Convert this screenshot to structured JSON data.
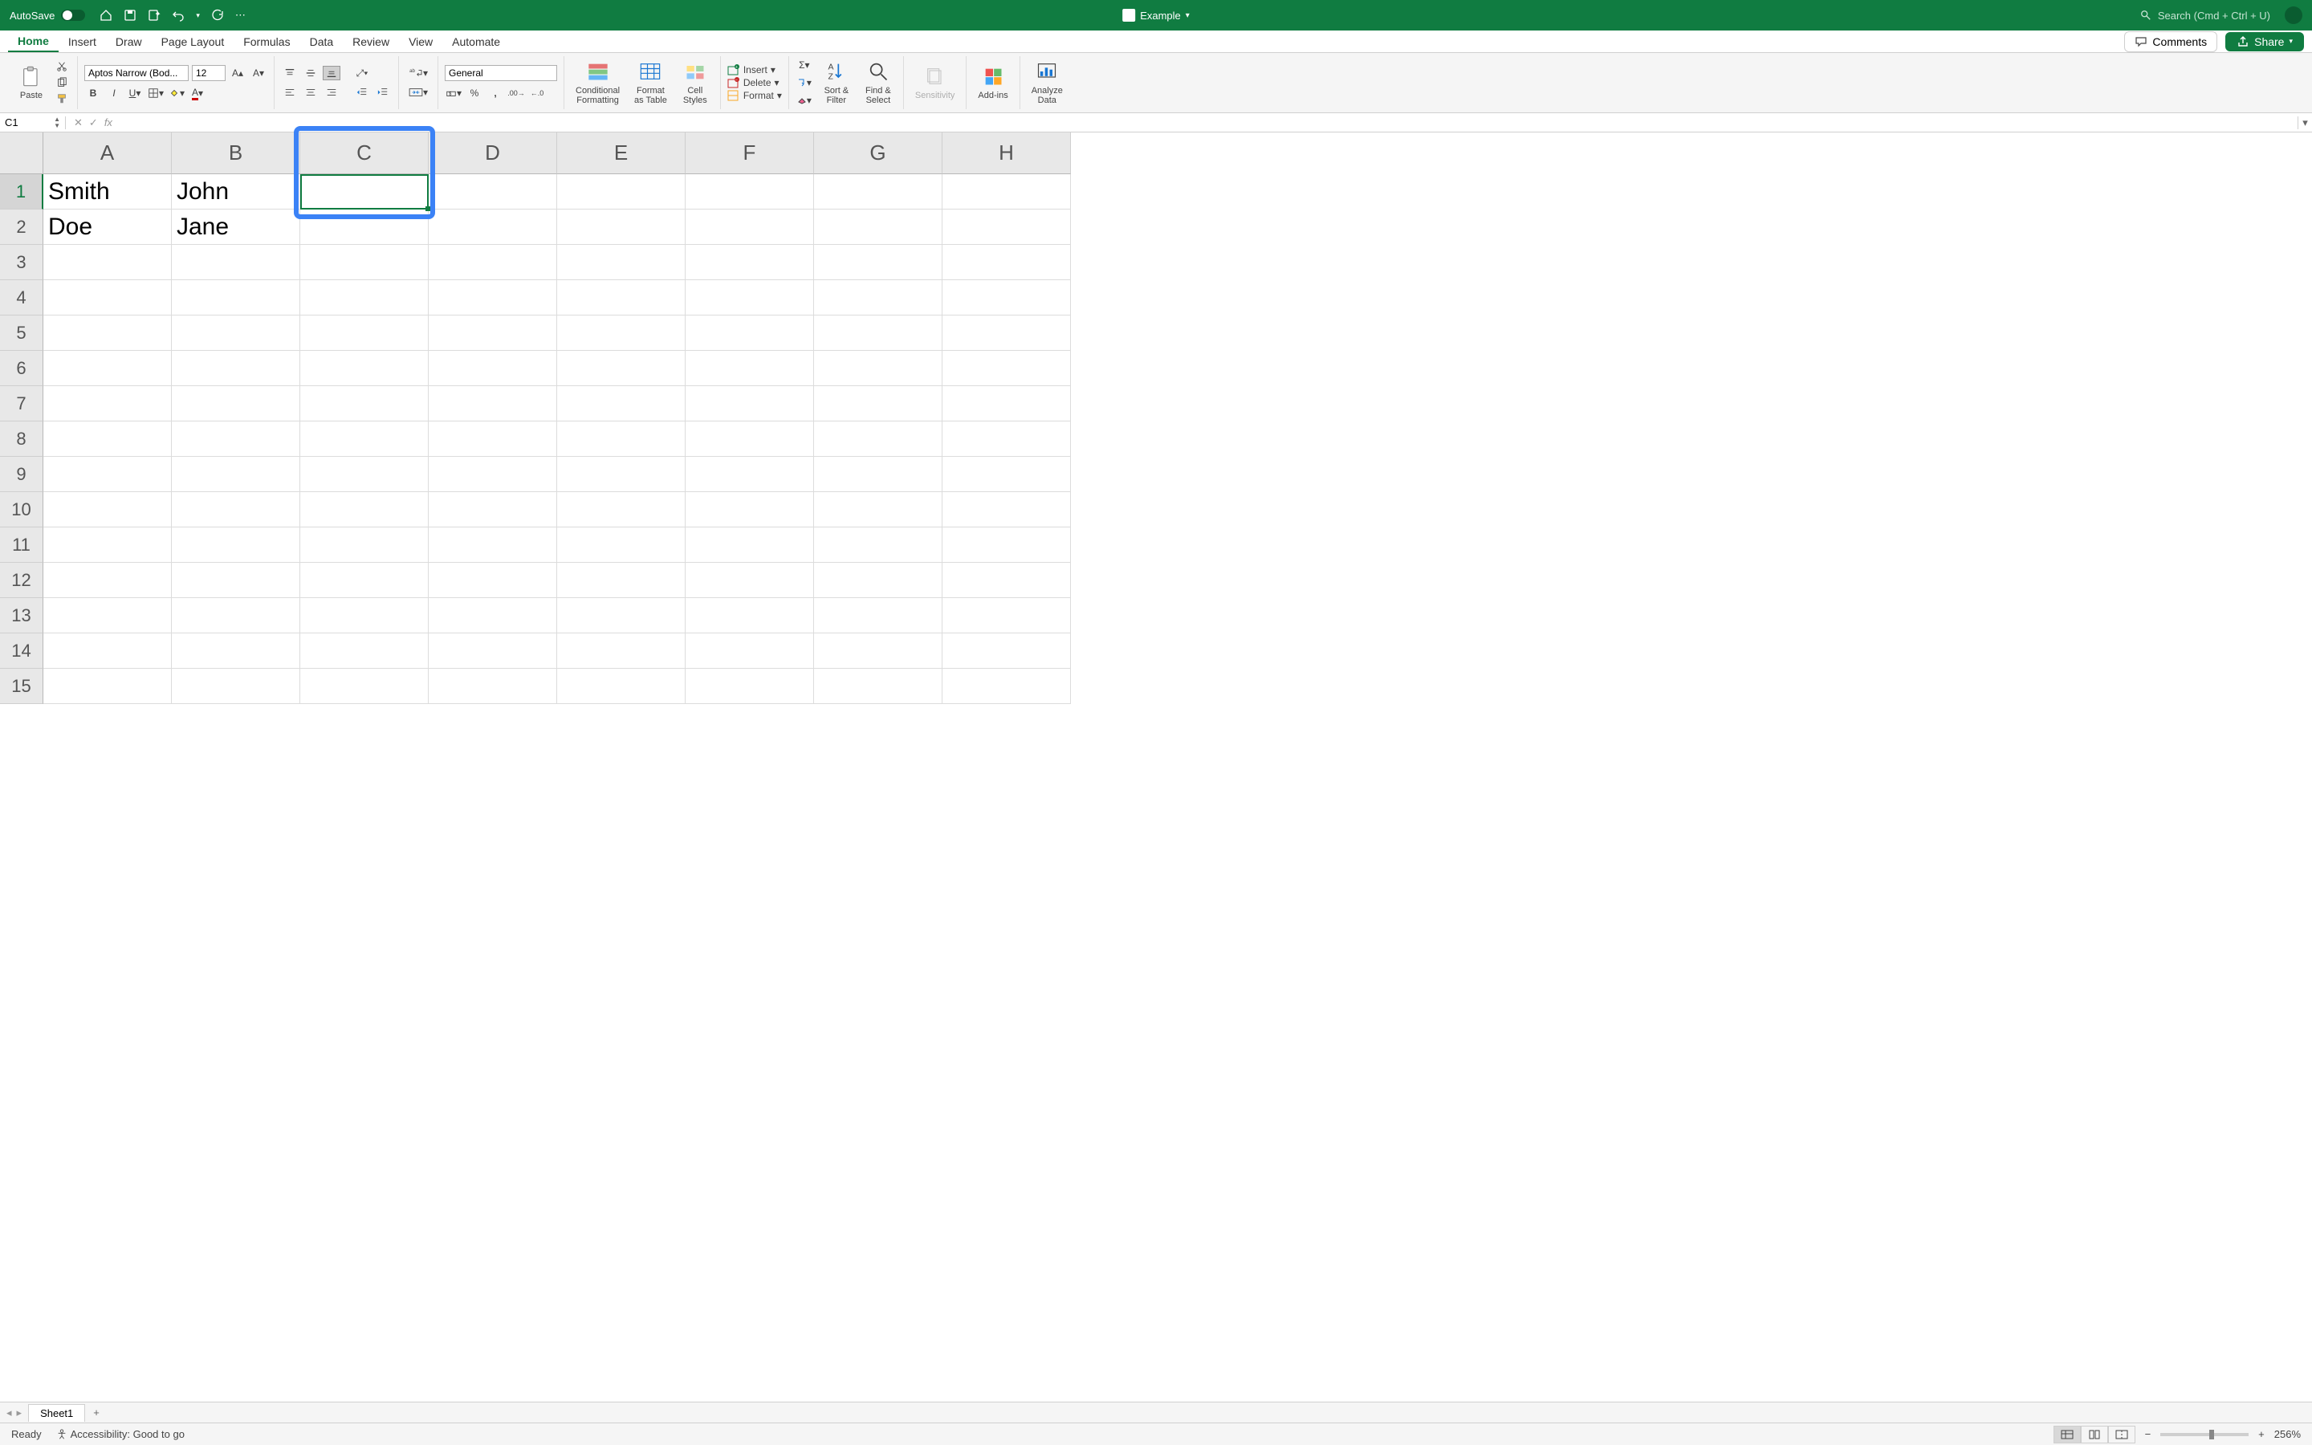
{
  "titlebar": {
    "autosave_label": "AutoSave",
    "doc_name": "Example",
    "search_placeholder": "Search (Cmd + Ctrl + U)"
  },
  "tabs": [
    "Home",
    "Insert",
    "Draw",
    "Page Layout",
    "Formulas",
    "Data",
    "Review",
    "View",
    "Automate"
  ],
  "active_tab": "Home",
  "ribbon_right": {
    "comments": "Comments",
    "share": "Share"
  },
  "ribbon": {
    "paste": "Paste",
    "font_name": "Aptos Narrow (Bod...",
    "font_size": "12",
    "number_format": "General",
    "cond_fmt": "Conditional\nFormatting",
    "fmt_table": "Format\nas Table",
    "cell_styles": "Cell\nStyles",
    "insert": "Insert",
    "delete": "Delete",
    "format": "Format",
    "sort_filter": "Sort &\nFilter",
    "find_select": "Find &\nSelect",
    "sensitivity": "Sensitivity",
    "addins": "Add-ins",
    "analyze": "Analyze\nData"
  },
  "name_box": "C1",
  "formula": "",
  "columns": [
    "A",
    "B",
    "C",
    "D",
    "E",
    "F",
    "G",
    "H"
  ],
  "rows": [
    1,
    2,
    3,
    4,
    5,
    6,
    7,
    8,
    9,
    10,
    11,
    12,
    13,
    14,
    15
  ],
  "active_row": 1,
  "selected_cell": {
    "col": 2,
    "row": 0
  },
  "data": [
    [
      "Smith",
      "John",
      "",
      "",
      "",
      "",
      "",
      ""
    ],
    [
      "Doe",
      "Jane",
      "",
      "",
      "",
      "",
      "",
      ""
    ]
  ],
  "sheet_tabs": [
    "Sheet1"
  ],
  "status": {
    "ready": "Ready",
    "accessibility": "Accessibility: Good to go",
    "zoom": "256%"
  },
  "colors": {
    "brand": "#107c41",
    "highlight": "#3b82f6"
  }
}
